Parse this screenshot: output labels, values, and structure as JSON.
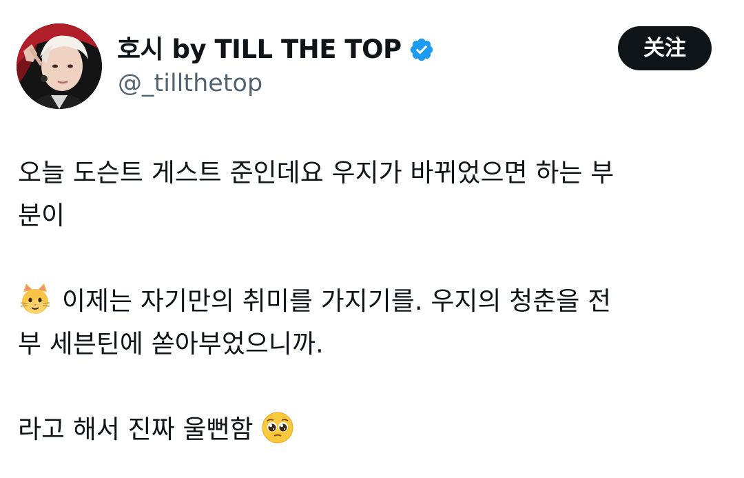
{
  "author": {
    "display_name": "호시 by TILL THE TOP",
    "handle": "@_tillthetop",
    "verified": true,
    "verified_color": "#1d9bf0",
    "avatar_icon": "profile-photo"
  },
  "follow_button": {
    "label": "关注",
    "background": "#0f1419",
    "text_color": "#ffffff"
  },
  "tweet": {
    "paragraph1": {
      "line1": "오늘 도슨트 게스트 준인데요 우지가 바뀌었으면 하는 부",
      "line2": "분이"
    },
    "paragraph2": {
      "emoji": "cat-face-emoji",
      "line1": "이제는 자기만의 취미를 가지기를. 우지의 청춘을 전",
      "line2": "부 세븐틴에 쏟아부었으니까."
    },
    "paragraph3": {
      "text": "라고 해서 진짜 울뻔함",
      "emoji": "pleading-face-emoji"
    }
  },
  "colors": {
    "text": "#0f1419",
    "secondary_text": "#536471",
    "background": "#ffffff"
  }
}
